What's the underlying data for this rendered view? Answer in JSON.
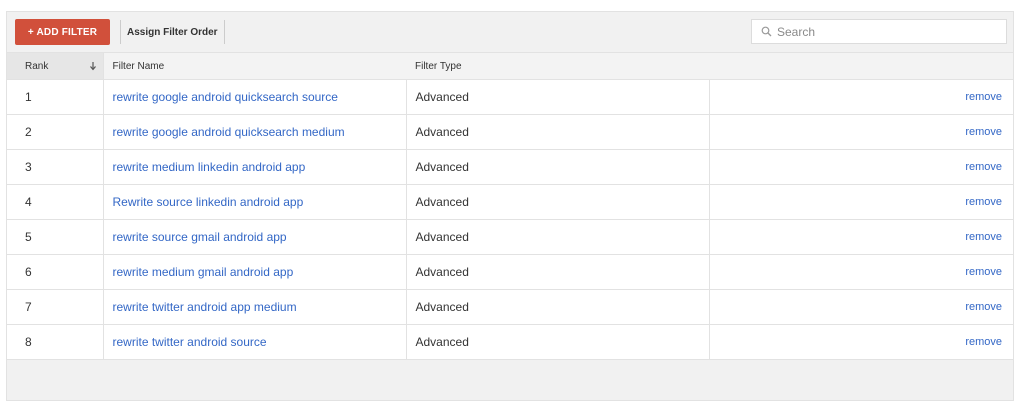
{
  "toolbar": {
    "add_filter_label": "+ ADD FILTER",
    "assign_order_label": "Assign Filter Order"
  },
  "search": {
    "placeholder": "Search",
    "value": ""
  },
  "table": {
    "columns": [
      "Rank",
      "Filter Name",
      "Filter Type",
      ""
    ],
    "sort_indicator": "down-arrow-icon",
    "rows": [
      {
        "rank": "1",
        "name": "rewrite google android quicksearch source",
        "type": "Advanced",
        "action": "remove"
      },
      {
        "rank": "2",
        "name": "rewrite google android quicksearch medium",
        "type": "Advanced",
        "action": "remove"
      },
      {
        "rank": "3",
        "name": "rewrite medium linkedin android app",
        "type": "Advanced",
        "action": "remove"
      },
      {
        "rank": "4",
        "name": "Rewrite source linkedin android app",
        "type": "Advanced",
        "action": "remove"
      },
      {
        "rank": "5",
        "name": "rewrite source gmail android app",
        "type": "Advanced",
        "action": "remove"
      },
      {
        "rank": "6",
        "name": "rewrite medium gmail android app",
        "type": "Advanced",
        "action": "remove"
      },
      {
        "rank": "7",
        "name": "rewrite twitter android app medium",
        "type": "Advanced",
        "action": "remove"
      },
      {
        "rank": "8",
        "name": "rewrite twitter android source",
        "type": "Advanced",
        "action": "remove"
      }
    ]
  },
  "colors": {
    "primary_button": "#d1503b",
    "link": "#3367c6",
    "header_bg": "#f3f3f3",
    "sorted_header_bg": "#e6e6e6",
    "frame_bg": "#f1f1f1"
  }
}
